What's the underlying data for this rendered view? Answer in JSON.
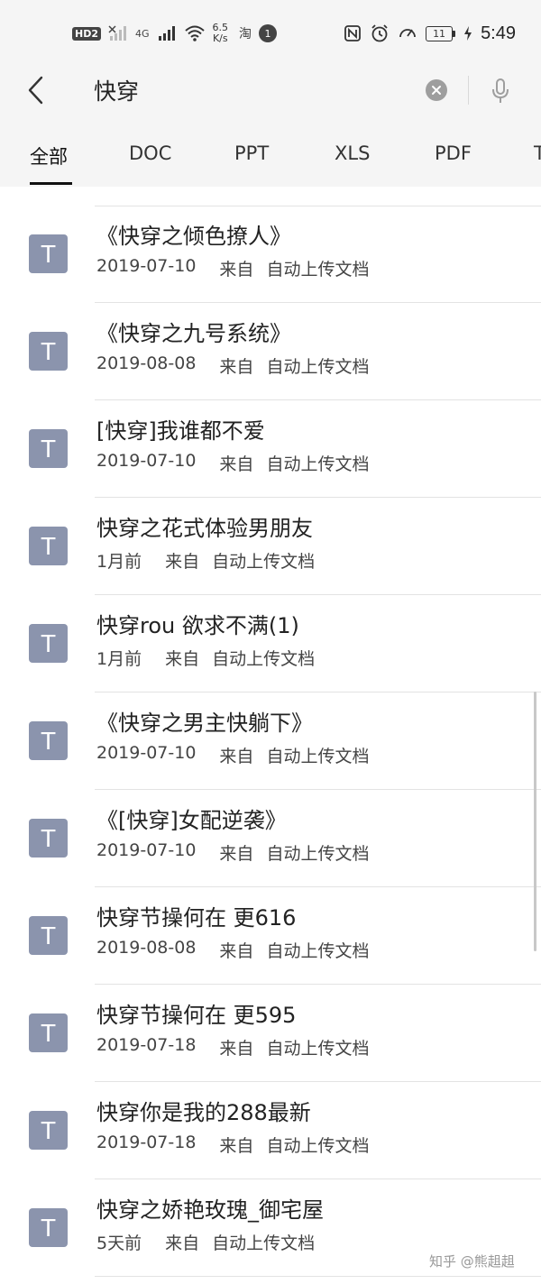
{
  "status_bar": {
    "hd_badge": "HD",
    "hd_sub": "2",
    "net": "4G",
    "speed_value": "6.5",
    "speed_unit": "K/s",
    "taobao": "淘",
    "badge_num": "1",
    "battery": "11",
    "time": "5:49",
    "icons": [
      "hd-icon",
      "no-sim-signal-icon",
      "4g-signal-icon",
      "wifi-icon",
      "taobao-icon",
      "notification-badge-icon",
      "nfc-icon",
      "alarm-icon",
      "speedometer-icon",
      "battery-icon"
    ]
  },
  "search": {
    "query": "快穿",
    "back_icon": "back-arrow-icon",
    "clear_icon": "clear-icon",
    "mic_icon": "microphone-icon"
  },
  "tabs": [
    {
      "label": "全部",
      "active": true
    },
    {
      "label": "DOC"
    },
    {
      "label": "PPT"
    },
    {
      "label": "XLS"
    },
    {
      "label": "PDF"
    },
    {
      "label": "T"
    }
  ],
  "files": [
    {
      "title": "《快穿之倾色撩人》",
      "date": "2019-07-10",
      "from": "来自",
      "source": "自动上传文档",
      "icon_letter": "T"
    },
    {
      "title": "《快穿之九号系统》",
      "date": "2019-08-08",
      "from": "来自",
      "source": "自动上传文档",
      "icon_letter": "T"
    },
    {
      "title": "[快穿]我谁都不爱",
      "date": "2019-07-10",
      "from": "来自",
      "source": "自动上传文档",
      "icon_letter": "T"
    },
    {
      "title": "快穿之花式体验男朋友",
      "date": "1月前",
      "from": "来自",
      "source": "自动上传文档",
      "icon_letter": "T"
    },
    {
      "title": "快穿rou 欲求不满(1)",
      "date": "1月前",
      "from": "来自",
      "source": "自动上传文档",
      "icon_letter": "T"
    },
    {
      "title": "《快穿之男主快躺下》",
      "date": "2019-07-10",
      "from": "来自",
      "source": "自动上传文档",
      "icon_letter": "T"
    },
    {
      "title": "《[快穿]女配逆袭》",
      "date": "2019-07-10",
      "from": "来自",
      "source": "自动上传文档",
      "icon_letter": "T"
    },
    {
      "title": "快穿节操何在 更616",
      "date": "2019-08-08",
      "from": "来自",
      "source": "自动上传文档",
      "icon_letter": "T"
    },
    {
      "title": "快穿节操何在 更595",
      "date": "2019-07-18",
      "from": "来自",
      "source": "自动上传文档",
      "icon_letter": "T"
    },
    {
      "title": "快穿你是我的288最新",
      "date": "2019-07-18",
      "from": "来自",
      "source": "自动上传文档",
      "icon_letter": "T"
    },
    {
      "title": "快穿之娇艳玫瑰_御宅屋",
      "date": "5天前",
      "from": "来自",
      "source": "自动上传文档",
      "icon_letter": "T"
    }
  ],
  "watermark": "知乎 @熊趄趄",
  "colors": {
    "file_icon_bg": "#8b94ad",
    "header_bg": "#f5f5f5",
    "divider": "#e3e3e3",
    "active_tab": "#111111"
  }
}
